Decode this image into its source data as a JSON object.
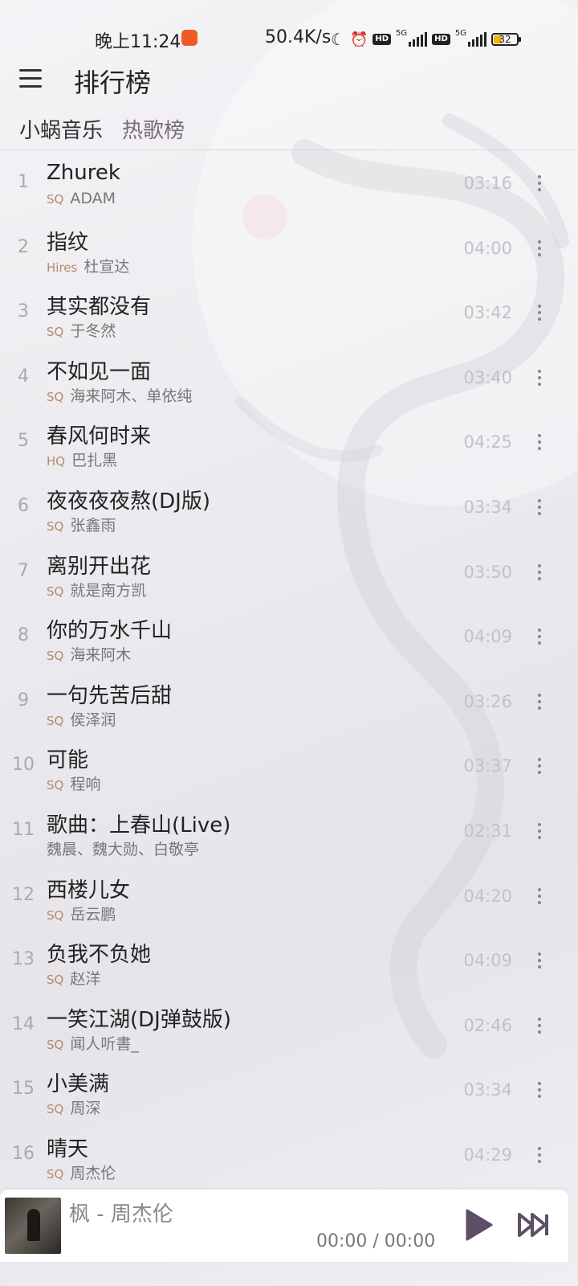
{
  "status_bar": {
    "time": "晚上11:24",
    "net_speed": "50.4K/s",
    "network_1": "5G",
    "network_2": "5G",
    "hd_label": "HD",
    "battery": "32"
  },
  "header": {
    "title": "排行榜",
    "icon": "menu-icon"
  },
  "tabs": [
    {
      "label": "小蜗音乐",
      "active": false
    },
    {
      "label": "热歌榜",
      "active": true
    }
  ],
  "songs": [
    {
      "rank": "1",
      "title": "Zhurek",
      "quality": "SQ",
      "artist": "ADAM",
      "duration": "03:16"
    },
    {
      "rank": "2",
      "title": "指纹",
      "quality": "Hires",
      "artist": "杜宣达",
      "duration": "04:00"
    },
    {
      "rank": "3",
      "title": "其实都没有",
      "quality": "SQ",
      "artist": "于冬然",
      "duration": "03:42"
    },
    {
      "rank": "4",
      "title": "不如见一面",
      "quality": "SQ",
      "artist": "海来阿木、单依纯",
      "duration": "03:40"
    },
    {
      "rank": "5",
      "title": "春风何时来",
      "quality": "HQ",
      "artist": "巴扎黑",
      "duration": "04:25"
    },
    {
      "rank": "6",
      "title": "夜夜夜夜熬(DJ版)",
      "quality": "SQ",
      "artist": "张鑫雨",
      "duration": "03:34"
    },
    {
      "rank": "7",
      "title": "离别开出花",
      "quality": "SQ",
      "artist": "就是南方凯",
      "duration": "03:50"
    },
    {
      "rank": "8",
      "title": "你的万水千山",
      "quality": "SQ",
      "artist": "海来阿木",
      "duration": "04:09"
    },
    {
      "rank": "9",
      "title": "一句先苦后甜",
      "quality": "SQ",
      "artist": "侯泽润",
      "duration": "03:26"
    },
    {
      "rank": "10",
      "title": "可能",
      "quality": "SQ",
      "artist": "程响",
      "duration": "03:37"
    },
    {
      "rank": "11",
      "title": "歌曲：上春山(Live)",
      "quality": "",
      "artist": "魏晨、魏大勋、白敬亭",
      "duration": "02:31"
    },
    {
      "rank": "12",
      "title": "西楼儿女",
      "quality": "SQ",
      "artist": "岳云鹏",
      "duration": "04:20"
    },
    {
      "rank": "13",
      "title": "负我不负她",
      "quality": "SQ",
      "artist": "赵洋",
      "duration": "04:09"
    },
    {
      "rank": "14",
      "title": "一笑江湖(DJ弹鼓版)",
      "quality": "SQ",
      "artist": "闻人听書_",
      "duration": "02:46"
    },
    {
      "rank": "15",
      "title": "小美满",
      "quality": "SQ",
      "artist": "周深",
      "duration": "03:34"
    },
    {
      "rank": "16",
      "title": "晴天",
      "quality": "SQ",
      "artist": "周杰伦",
      "duration": "04:29"
    }
  ],
  "player": {
    "now_playing": "枫 - 周杰伦",
    "time": "00:00 / 00:00",
    "play_icon": "play-icon",
    "next_icon": "skip-next-icon",
    "accent": "#5c4f66"
  }
}
